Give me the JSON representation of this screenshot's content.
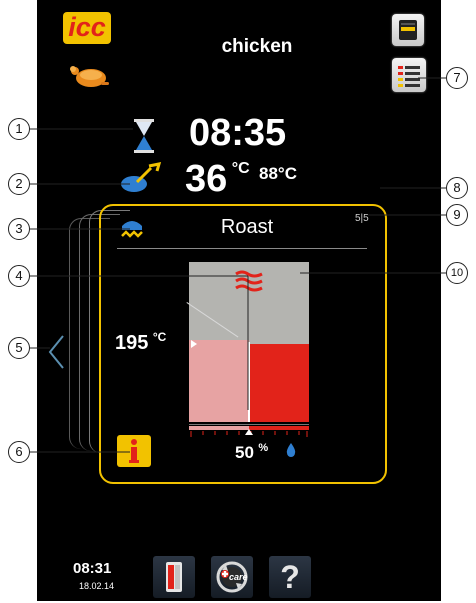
{
  "header": {
    "logo_text": "icc",
    "title": "chicken"
  },
  "cooking": {
    "time": "08:35",
    "core_temp": "36",
    "core_temp_unit": "°C",
    "target_temp": "88°C",
    "step_name": "Roast",
    "step_counter": "5|5",
    "cabinet_temp": "195",
    "cabinet_temp_unit": "°C",
    "humidity": "50",
    "humidity_unit": "%",
    "humidity_level": 0.5,
    "progress_level": 0.5
  },
  "callouts": [
    "1",
    "2",
    "3",
    "4",
    "5",
    "6",
    "7",
    "8",
    "9",
    "10"
  ],
  "footer": {
    "clock": "08:31",
    "date": "18.02.14",
    "care_label": "care",
    "help_label": "?"
  },
  "colors": {
    "accent_yellow": "#f2c200",
    "heat_red": "#e2231a",
    "light_red": "#e7a3a3",
    "panel_grey": "#b4b4b0",
    "icon_blue": "#2f7fd1"
  },
  "icons": [
    "icc-logo",
    "chicken-icon",
    "hourglass-icon",
    "core-probe-icon",
    "cooking-step-icon",
    "info-icon",
    "cabinet-icon",
    "step-list-icon",
    "heat-waves-icon",
    "humidity-drop-icon",
    "care-icon",
    "help-icon"
  ]
}
